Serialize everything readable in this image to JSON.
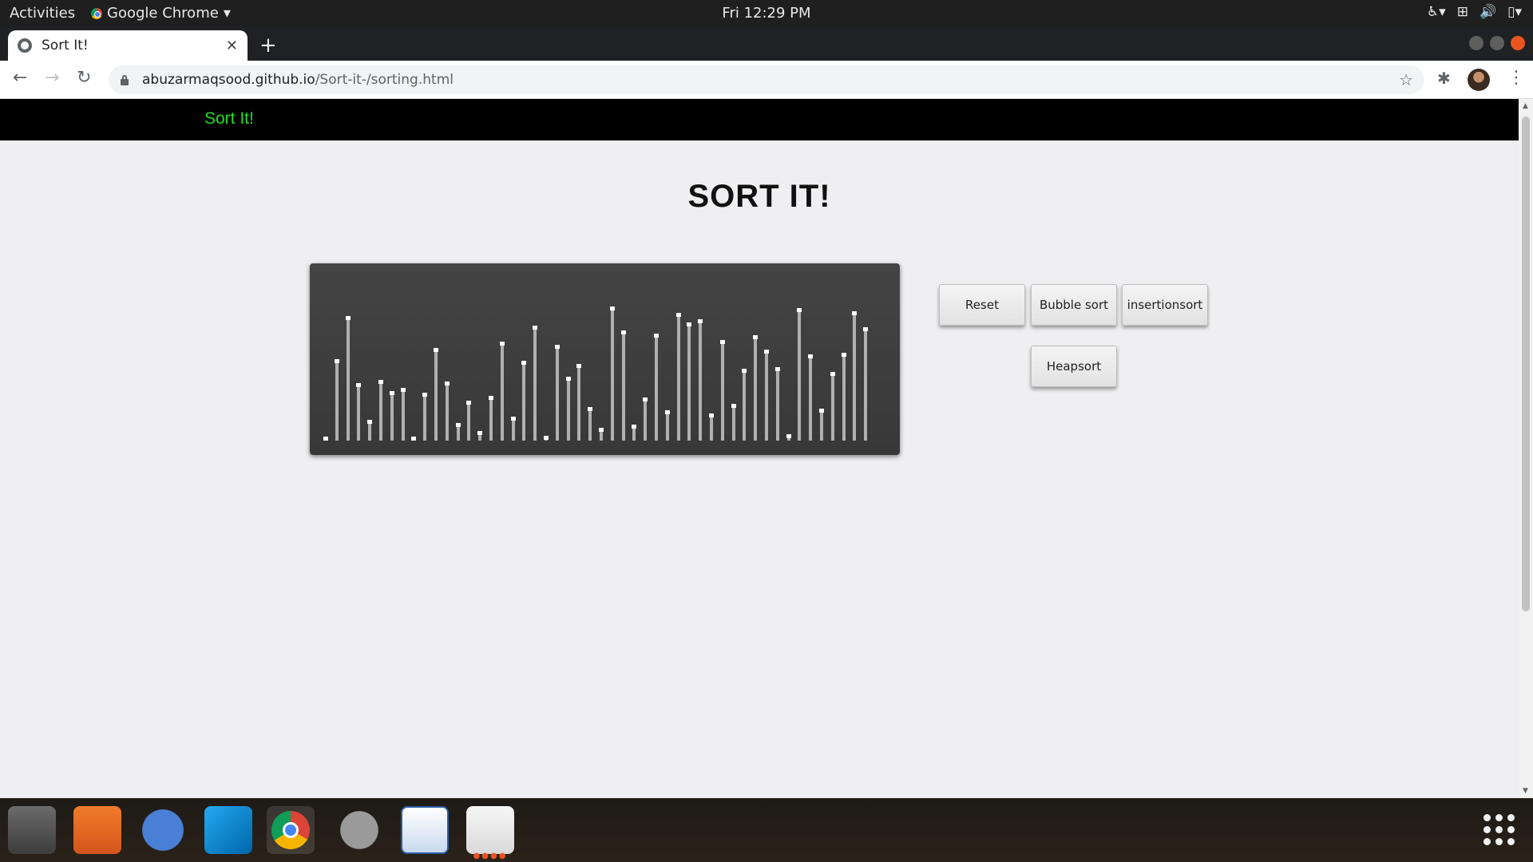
{
  "system": {
    "activities": "Activities",
    "app_name": "Google Chrome",
    "clock": "Fri 12:29 PM"
  },
  "browser": {
    "tab_title": "Sort It!",
    "url_domain": "abuzarmaqsood.github.io",
    "url_path": "/Sort-it-/sorting.html"
  },
  "page": {
    "brand": "Sort It!",
    "heading": "SORT IT!",
    "buttons": {
      "reset": "Reset",
      "bubble": "Bubble sort",
      "insertion": "insertionsort",
      "heap": "Heapsort"
    },
    "bars": [
      2,
      51,
      78,
      36,
      13,
      38,
      31,
      33,
      2,
      30,
      58,
      37,
      11,
      25,
      6,
      28,
      62,
      15,
      50,
      72,
      3,
      60,
      40,
      48,
      21,
      8,
      84,
      69,
      10,
      27,
      67,
      19,
      80,
      74,
      76,
      17,
      63,
      23,
      45,
      66,
      57,
      46,
      4,
      83,
      54,
      20,
      43,
      55,
      81,
      71
    ]
  },
  "dock": {
    "items": [
      "files-icon",
      "software-icon",
      "help-icon",
      "vscode-icon",
      "chrome-icon",
      "settings-icon",
      "image-viewer-icon",
      "evince-icon"
    ]
  }
}
